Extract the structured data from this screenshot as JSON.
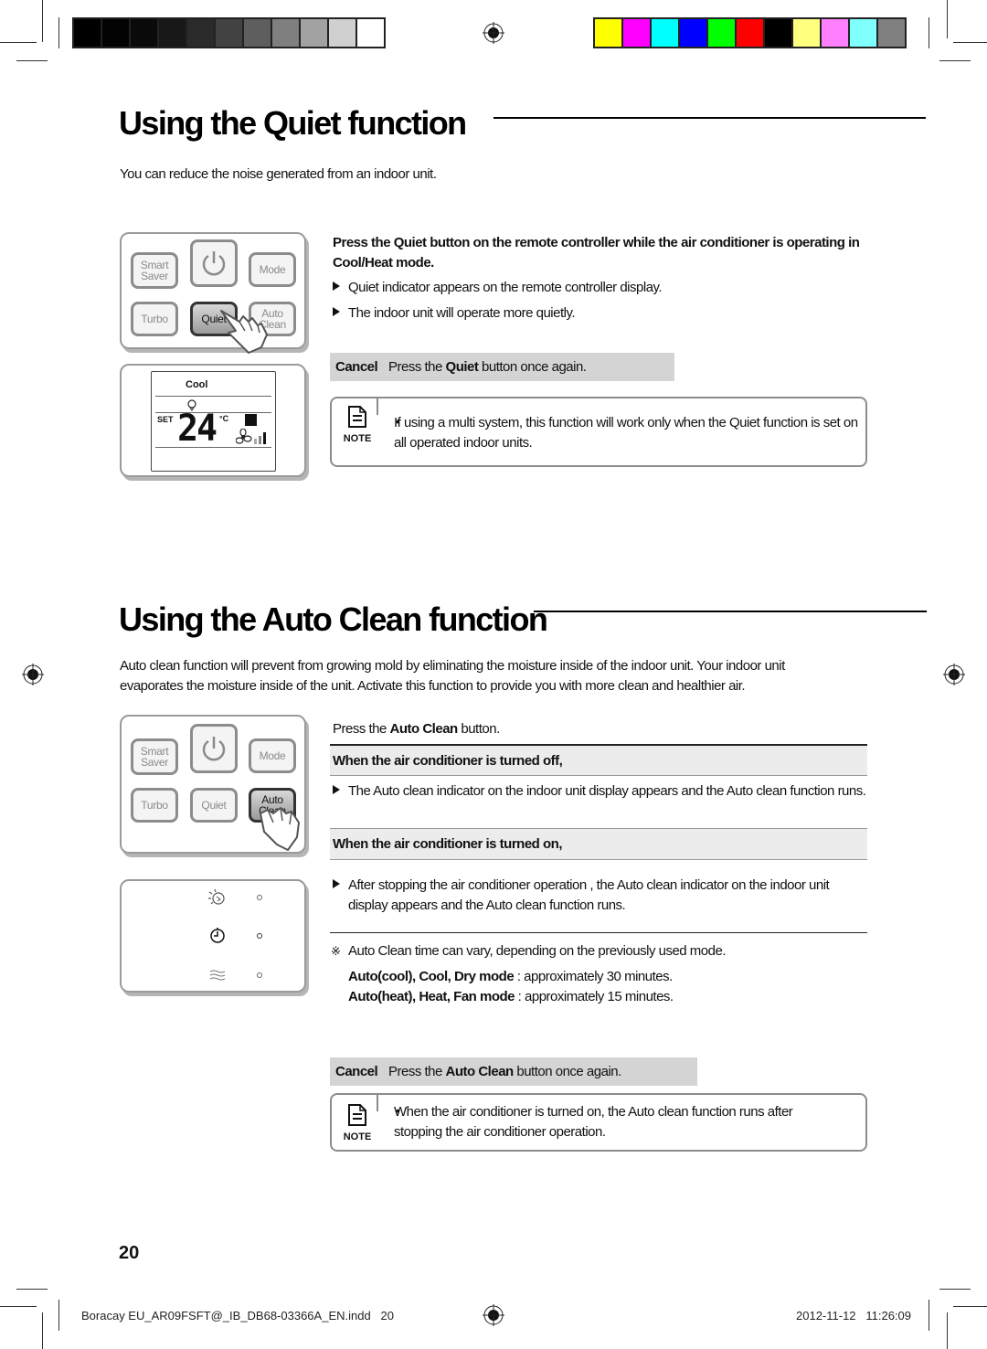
{
  "print_marks": {
    "grayscale_swatches": [
      "#000000",
      "#030303",
      "#0a0a0a",
      "#181818",
      "#2a2a2a",
      "#424242",
      "#5e5e5e",
      "#7f7f7f",
      "#a2a2a2",
      "#d0d0d0",
      "#ffffff"
    ],
    "color_swatches": [
      "#ffff00",
      "#ff00ff",
      "#00ffff",
      "#0000ff",
      "#00ff00",
      "#ff0000",
      "#000000",
      "#ffff80",
      "#ff80ff",
      "#80ffff",
      "#808080"
    ]
  },
  "quiet": {
    "title": "Using the Quiet function",
    "intro": "You can reduce the noise generated from an indoor unit.",
    "instruction": {
      "pre": "Press the ",
      "bold": "Quiet",
      "post": " button on the remote controller while the air conditioner is operating in Cool/Heat mode."
    },
    "bullets": [
      "Quiet indicator appears on the remote controller display.",
      "The indoor unit will operate more quietly."
    ],
    "cancel": {
      "label": "Cancel",
      "pre": "Press the ",
      "bold": "Quiet",
      "post": " button once again."
    },
    "note": {
      "icon_label": "NOTE",
      "bullet": "•",
      "text": "If using a multi system, this function will work only when the Quiet function is set on all operated indoor units."
    },
    "remote": {
      "buttons": {
        "smart_saver": "Smart Saver",
        "power": "power-icon",
        "mode": "Mode",
        "turbo": "Turbo",
        "quiet": "Quiet",
        "auto_clean": "Auto Clean"
      },
      "active_button": "Quiet"
    },
    "display": {
      "mode": "Cool",
      "set_label": "SET",
      "temperature": "24",
      "unit": "°C"
    }
  },
  "auto_clean": {
    "title": "Using the Auto Clean function",
    "intro": "Auto clean function will prevent from growing mold by eliminating the moisture inside of the indoor unit. Your indoor unit evaporates the moisture inside of the unit. Activate this function to provide you with more clean and healthier air.",
    "instruction": {
      "pre": "Press the ",
      "bold": "Auto Clean",
      "post": " button."
    },
    "when_off": {
      "heading": "When the air conditioner is turned off,",
      "bullet": "The Auto clean indicator on the indoor unit display appears and the Auto clean function runs."
    },
    "when_on": {
      "heading": "When the air conditioner is turned on,",
      "bullet": "After stopping the air conditioner operation , the Auto clean indicator on the indoor unit display appears and the Auto clean function runs."
    },
    "remark": {
      "symbol": "※",
      "text": "Auto Clean time can vary, depending on the previously used mode.",
      "lines": [
        {
          "bold": "Auto(cool), Cool, Dry mode",
          "text": " : approximately 30 minutes."
        },
        {
          "bold": "Auto(heat), Heat, Fan mode",
          "text": " : approximately 15 minutes."
        }
      ]
    },
    "cancel": {
      "label": "Cancel",
      "pre": "Press the ",
      "bold": "Auto Clean",
      "post": " button once again."
    },
    "note": {
      "icon_label": "NOTE",
      "bullet": "•",
      "text": "When the air conditioner is turned on, the Auto clean function runs after stopping the air conditioner operation."
    },
    "remote": {
      "buttons": {
        "smart_saver": "Smart Saver",
        "power": "power-icon",
        "mode": "Mode",
        "turbo": "Turbo",
        "quiet": "Quiet",
        "auto_clean": "Auto Clean"
      },
      "active_button": "Auto Clean"
    },
    "indoor_display": {
      "indicators": [
        "auto-clean-indicator",
        "timer-indicator",
        "quiet-indicator"
      ]
    }
  },
  "page_number": "20",
  "footer": {
    "file": "Boracay EU_AR09FSFT@_IB_DB68-03366A_EN.indd   20",
    "timestamp": "2012-11-12   11:26:09"
  }
}
